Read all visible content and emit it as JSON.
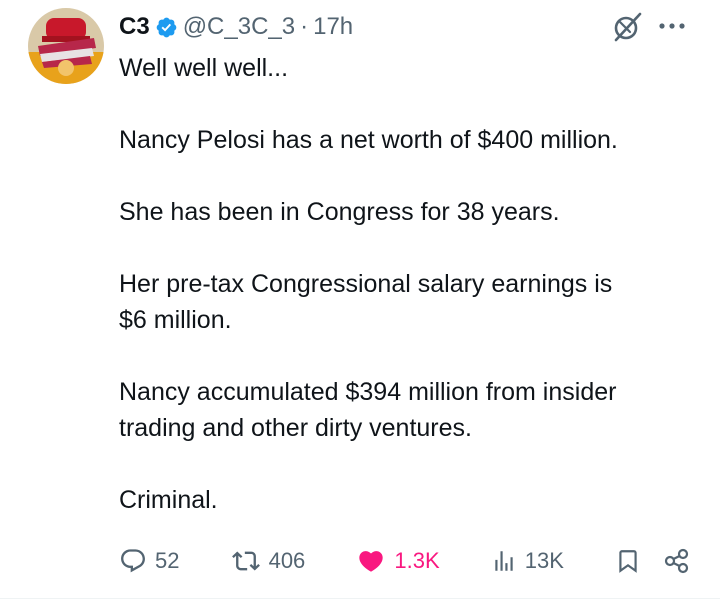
{
  "author": {
    "name": "C3",
    "handle": "@C_3C_3",
    "separator": "·",
    "time": "17h",
    "verified": true
  },
  "header_icons": {
    "grok": "grok-icon",
    "more": "more-icon"
  },
  "tweet": {
    "lines": [
      "Well well well...",
      "Nancy Pelosi has a net worth of $400 million.",
      "She has been in Congress for 38 years.",
      "Her pre-tax Congressional salary earnings is",
      "$6 million.",
      "Nancy accumulated $394 million from insider",
      "trading and other dirty ventures.",
      "Criminal."
    ]
  },
  "actions": {
    "replies": {
      "icon": "reply-icon",
      "count": "52"
    },
    "reposts": {
      "icon": "repost-icon",
      "count": "406"
    },
    "likes": {
      "icon": "heart-icon",
      "count": "1.3K",
      "liked": true
    },
    "views": {
      "icon": "views-icon",
      "count": "13K"
    },
    "bookmark": {
      "icon": "bookmark-icon"
    },
    "share": {
      "icon": "share-icon"
    }
  },
  "colors": {
    "text": "#0f1419",
    "secondary": "#536471",
    "verified": "#1d9bf0",
    "like": "#f91880"
  }
}
